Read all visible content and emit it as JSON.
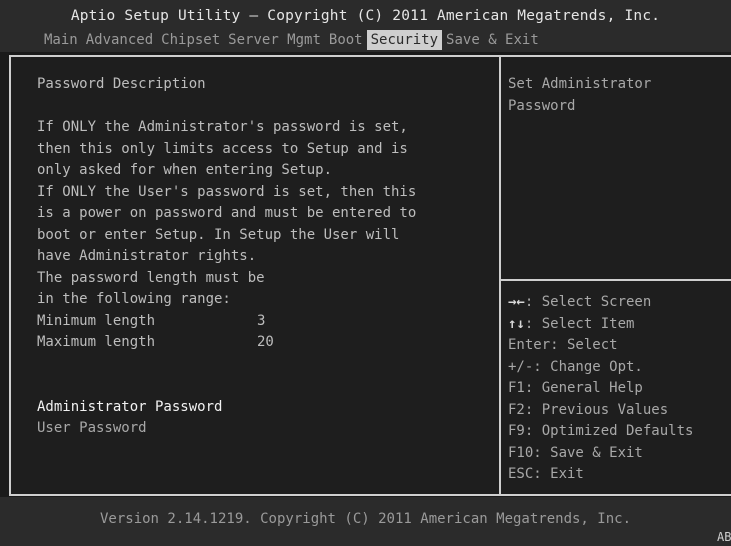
{
  "header": {
    "title": "Aptio Setup Utility – Copyright (C) 2011 American Megatrends, Inc.",
    "tabs": [
      "Main",
      "Advanced",
      "Chipset",
      "Server Mgmt",
      "Boot",
      "Security",
      "Save & Exit"
    ],
    "active_tab": "Security"
  },
  "main": {
    "heading": "Password Description",
    "description_lines": [
      "If ONLY the Administrator's password is set,",
      "then this only limits access to Setup and is",
      "only asked for when entering Setup.",
      "If ONLY the User's password is set, then this",
      "is a power on password and must be entered to",
      "boot or enter Setup. In Setup the User will",
      "have Administrator rights.",
      "The password length must be",
      "in the following range:"
    ],
    "min_label": "Minimum length",
    "min_value": "3",
    "max_label": "Maximum length",
    "max_value": "20",
    "items": [
      {
        "label": "Administrator Password",
        "selected": true
      },
      {
        "label": "User Password",
        "selected": false
      }
    ]
  },
  "help": {
    "lines": [
      "Set Administrator",
      "Password"
    ],
    "keys": [
      {
        "key": "→←",
        "desc": ": Select Screen"
      },
      {
        "key": "↑↓",
        "desc": ": Select Item"
      },
      {
        "key": "",
        "desc": "Enter: Select"
      },
      {
        "key": "",
        "desc": "+/-: Change Opt."
      },
      {
        "key": "",
        "desc": "F1: General Help"
      },
      {
        "key": "",
        "desc": "F2: Previous Values"
      },
      {
        "key": "",
        "desc": "F9: Optimized Defaults"
      },
      {
        "key": "",
        "desc": "F10: Save & Exit"
      },
      {
        "key": "",
        "desc": "ESC: Exit"
      }
    ]
  },
  "footer": {
    "version": "Version 2.14.1219. Copyright (C) 2011 American Megatrends, Inc.",
    "corner_text": "AB"
  }
}
